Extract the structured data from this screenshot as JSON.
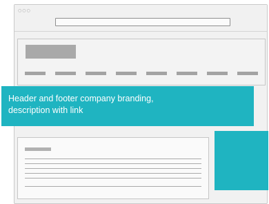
{
  "browser": {
    "window_dots": "○○○",
    "address_value": ""
  },
  "banner": {
    "text_line_1": "Header and footer company branding,",
    "text_line_2": "description with link"
  },
  "colors": {
    "accent": "#1fb4c1",
    "placeholder": "#a9a9a9",
    "window_bg": "#f1f1f1"
  },
  "nav": {
    "item_count": 8
  },
  "card": {
    "line_count": 5
  }
}
